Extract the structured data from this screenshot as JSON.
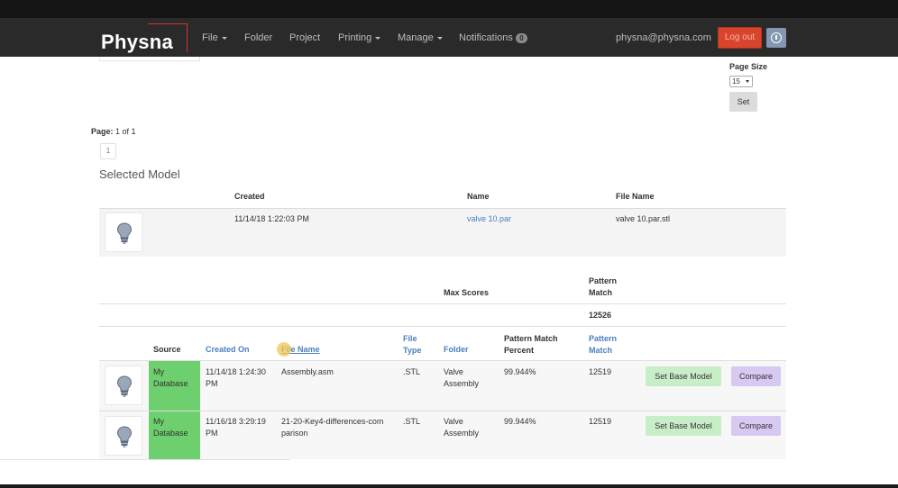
{
  "navbar": {
    "brand": "Physna",
    "items": [
      {
        "label": "File",
        "dropdown": true
      },
      {
        "label": "Folder",
        "dropdown": false
      },
      {
        "label": "Project",
        "dropdown": false
      },
      {
        "label": "Printing",
        "dropdown": true
      },
      {
        "label": "Manage",
        "dropdown": true
      },
      {
        "label": "Notifications",
        "dropdown": false
      }
    ],
    "notifications_count": "0",
    "user_email": "physna@physna.com",
    "logout_label": "Log out",
    "colors": {
      "bar": "#2a2a2a",
      "logout": "#d9452c",
      "info": "#8496b0",
      "brand_accent": "#d9302c"
    }
  },
  "page_size": {
    "label": "Page Size",
    "selected": "15",
    "set_label": "Set"
  },
  "pagination": {
    "label": "Page:",
    "value": "1 of 1",
    "current": "1"
  },
  "selected_model": {
    "title": "Selected Model",
    "headers": {
      "created": "Created",
      "name": "Name",
      "file_name": "File Name"
    },
    "row": {
      "icon": "lightbulb-icon",
      "created": "11/14/18 1:22:03 PM",
      "name": "valve 10.par",
      "file_name": "valve 10.par.stl"
    }
  },
  "results": {
    "max_scores_label": "Max Scores",
    "pattern_match_label": "Pattern Match",
    "pattern_match_max": "12526",
    "headers": {
      "source": "Source",
      "created_on": "Created On",
      "file_name": "File Name",
      "file_type": "File Type",
      "folder": "Folder",
      "pattern_match_percent": "Pattern Match Percent",
      "pattern_match": "Pattern Match"
    },
    "rows": [
      {
        "source": "My Database",
        "created_on": "11/14/18 1:24:30 PM",
        "file_name": "Assembly.asm",
        "file_type": ".STL",
        "folder": "Valve Assembly",
        "pattern_match_percent": "99.944%",
        "pattern_match": "12519",
        "set_base_label": "Set Base Model",
        "compare_label": "Compare"
      },
      {
        "source": "My Database",
        "created_on": "11/16/18 3:29:19 PM",
        "file_name": "21-20-Key4-differences-comparison",
        "file_type": ".STL",
        "folder": "Valve Assembly",
        "pattern_match_percent": "99.944%",
        "pattern_match": "12519",
        "set_base_label": "Set Base Model",
        "compare_label": "Compare"
      }
    ],
    "colors": {
      "source": "#6dcf6d",
      "set_base": "#c8eec8",
      "compare": "#d8c9f2",
      "link": "#4a7fc1"
    }
  }
}
